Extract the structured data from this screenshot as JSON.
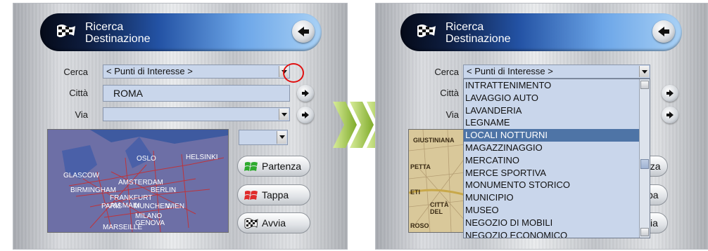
{
  "header": {
    "title_line1": "Ricerca",
    "title_line2": "Destinazione"
  },
  "form": {
    "cerca_label": "Cerca",
    "cerca_value": "< Punti di Interesse >",
    "citta_label": "Città",
    "citta_value": "ROMA",
    "via_label": "Via",
    "via_value": ""
  },
  "map_left": {
    "labels": [
      "OSLO",
      "HELSINKI",
      "GLASCOW",
      "BIRMINGHAM",
      "AMSTERDAM",
      "BERLIN",
      "FRANKFURT AM MAIN",
      "PARIS",
      "MUNCHEN",
      "WIEN",
      "MILANO",
      "GENOVA",
      "MARSEILLE"
    ]
  },
  "map_right": {
    "labels": [
      "GIUSTINIANA",
      "PETTA",
      "ETI",
      "CITTÀ DEL",
      "ROSO"
    ]
  },
  "buttons": {
    "partenza": "Partenza",
    "tappa": "Tappa",
    "avvia": "Avvia"
  },
  "buttons_right_partial": {
    "partenza": "nza",
    "tappa": "pa",
    "avvia": "ia"
  },
  "poi_list": [
    "INTRATTENIMENTO",
    "LAVAGGIO AUTO",
    "LAVANDERIA",
    "LEGNAME",
    "LOCALI NOTTURNI",
    "MAGAZZINAGGIO",
    "MERCATINO",
    "MERCE SPORTIVA",
    "MONUMENTO STORICO",
    "MUNICIPIO",
    "MUSEO",
    "NEGOZIO DI MOBILI",
    "NEGOZIO ECONOMICO"
  ],
  "poi_selected": "LOCALI NOTTURNI",
  "colors": {
    "field_bg": "#c9d6eb",
    "selected_bg": "#4e74a6",
    "highlight_circle": "#e01010",
    "transition_arrows": "#9bc43e"
  },
  "icons": [
    "checkered-flag-icon",
    "back-arrow-icon",
    "right-arrow-icon",
    "windows-flag-icon",
    "chevron-right-icon"
  ]
}
